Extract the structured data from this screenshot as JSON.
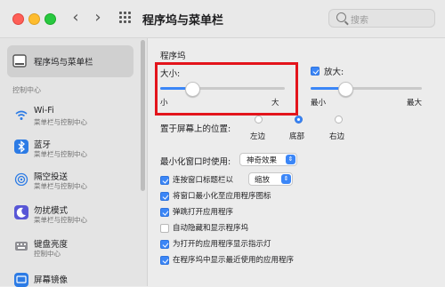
{
  "window": {
    "title": "程序坞与菜单栏",
    "search_placeholder": "搜索",
    "back_icon": "‹",
    "forward_icon": "›"
  },
  "sidebar": {
    "selected_item": {
      "label": "程序坞与菜单栏",
      "icon": "dock-icon"
    },
    "section_header": "控制中心",
    "items": [
      {
        "label": "Wi-Fi",
        "sub": "菜单栏与控制中心",
        "icon": "wifi-icon"
      },
      {
        "label": "蓝牙",
        "sub": "菜单栏与控制中心",
        "icon": "bluetooth-icon"
      },
      {
        "label": "隔空投送",
        "sub": "菜单栏与控制中心",
        "icon": "airdrop-icon"
      },
      {
        "label": "勿扰模式",
        "sub": "菜单栏与控制中心",
        "icon": "moon-icon"
      },
      {
        "label": "键盘亮度",
        "sub": "控制中心",
        "icon": "keyboard-brightness-icon"
      },
      {
        "label": "屏幕镜像",
        "sub": "",
        "icon": "screen-mirroring-icon"
      }
    ]
  },
  "content": {
    "section_title": "程序坞",
    "size": {
      "label": "大小:",
      "min": "小",
      "max": "大",
      "value": 0.25
    },
    "magnification": {
      "label": "放大:",
      "checked": true,
      "min": "最小",
      "max": "最大",
      "value": 0.3
    },
    "position": {
      "label": "置于屏幕上的位置:",
      "options": [
        "左边",
        "底部",
        "右边"
      ],
      "selected": "底部"
    },
    "minimize": {
      "label": "最小化窗口时使用:",
      "value": "神奇效果"
    },
    "options": [
      {
        "label": "连按窗口标题栏以",
        "checked": true,
        "popup": "缩放"
      },
      {
        "label": "将窗口最小化至应用程序图标",
        "checked": true
      },
      {
        "label": "弹跳打开应用程序",
        "checked": true
      },
      {
        "label": "自动隐藏和显示程序坞",
        "checked": false
      },
      {
        "label": "为打开的应用程序显示指示灯",
        "checked": true
      },
      {
        "label": "在程序坞中显示最近使用的应用程序",
        "checked": true
      }
    ]
  },
  "colors": {
    "accent": "#3b86f7",
    "highlight": "#e3141b"
  }
}
